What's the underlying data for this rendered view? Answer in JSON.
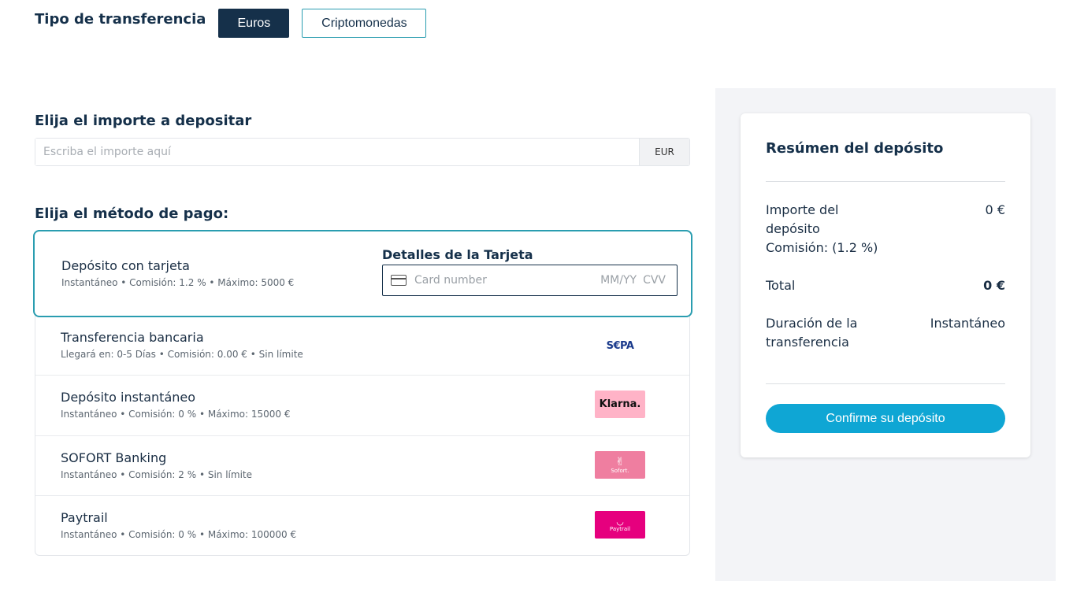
{
  "transfer_type": {
    "label": "Tipo de transferencia",
    "options": [
      "Euros",
      "Criptomonedas"
    ],
    "selected": "Euros"
  },
  "amount": {
    "title": "Elija el importe a depositar",
    "placeholder": "Escriba el importe aquí",
    "currency": "EUR"
  },
  "payment_methods": {
    "title": "Elija el método de pago:",
    "items": [
      {
        "name": "Depósito con tarjeta",
        "meta": "Instantáneo • Comisión: 1.2 % • Máximo: 5000 €"
      },
      {
        "name": "Transferencia bancaria",
        "meta": "Llegará en: 0-5 Días • Comisión: 0.00 € • Sin límite",
        "logo": "S€PA"
      },
      {
        "name": "Depósito instantáneo",
        "meta": "Instantáneo • Comisión: 0 % • Máximo: 15000 €",
        "logo": "Klarna."
      },
      {
        "name": "SOFORT Banking",
        "meta": "Instantáneo • Comisión: 2 % • Sin límite",
        "logo": "Sofort."
      },
      {
        "name": "Paytrail",
        "meta": "Instantáneo • Comisión: 0 % • Máximo: 100000 €",
        "logo": "Paytrail"
      }
    ]
  },
  "card_details": {
    "title": "Detalles de la Tarjeta",
    "number_placeholder": "Card number",
    "expiry_placeholder": "MM/YY",
    "cvv_placeholder": "CVV"
  },
  "summary": {
    "title": "Resúmen del depósito",
    "rows": [
      {
        "label": "Importe del depósito",
        "value": "0 €"
      },
      {
        "label": "Comisión: (1.2 %)",
        "value": ""
      },
      {
        "label": "Total",
        "value": "0 €"
      },
      {
        "label": "Duración de la transferencia",
        "value": "Instantáneo"
      }
    ],
    "confirm_label": "Confirme su depósito"
  }
}
